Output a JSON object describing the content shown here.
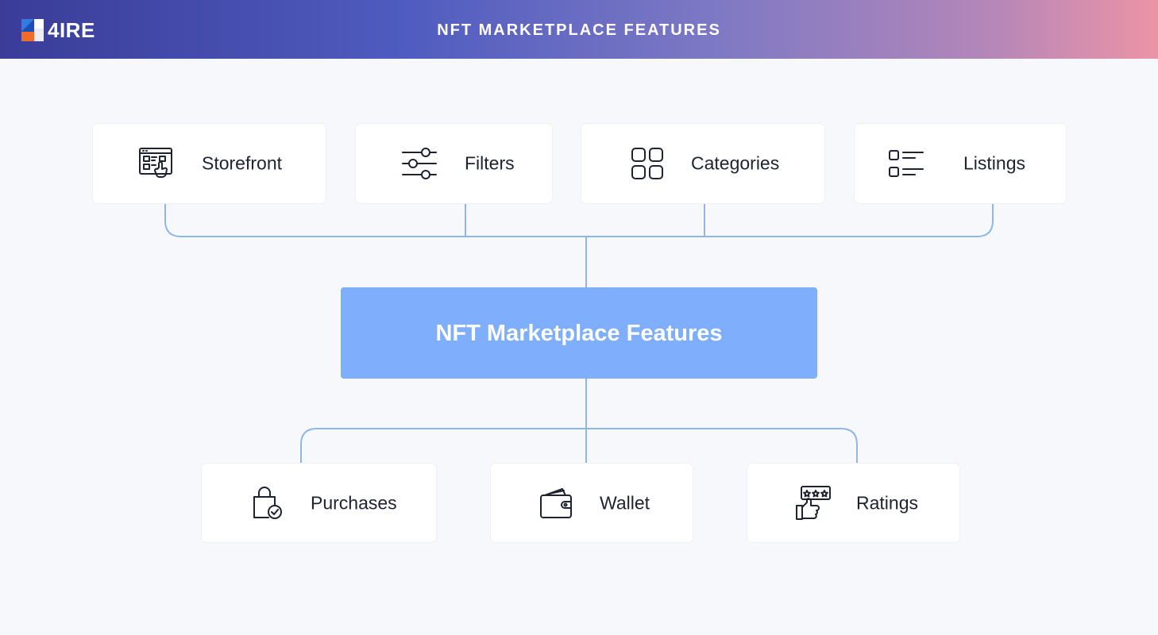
{
  "header": {
    "logo_text": "4IRE",
    "title": "NFT MARKETPLACE FEATURES"
  },
  "center": {
    "label": "NFT Marketplace Features"
  },
  "top_features": [
    {
      "label": "Storefront",
      "icon": "storefront-icon"
    },
    {
      "label": "Filters",
      "icon": "sliders-icon"
    },
    {
      "label": "Categories",
      "icon": "grid-icon"
    },
    {
      "label": "Listings",
      "icon": "list-icon"
    }
  ],
  "bottom_features": [
    {
      "label": "Purchases",
      "icon": "shopping-bag-check-icon"
    },
    {
      "label": "Wallet",
      "icon": "wallet-icon"
    },
    {
      "label": "Ratings",
      "icon": "thumbs-up-rating-icon"
    }
  ],
  "colors": {
    "connector": "#8fb6ea",
    "center_box": "#7eaefc",
    "background": "#f7f8fb",
    "logo_blue": "#2f7de1",
    "logo_orange": "#f26b2a"
  }
}
